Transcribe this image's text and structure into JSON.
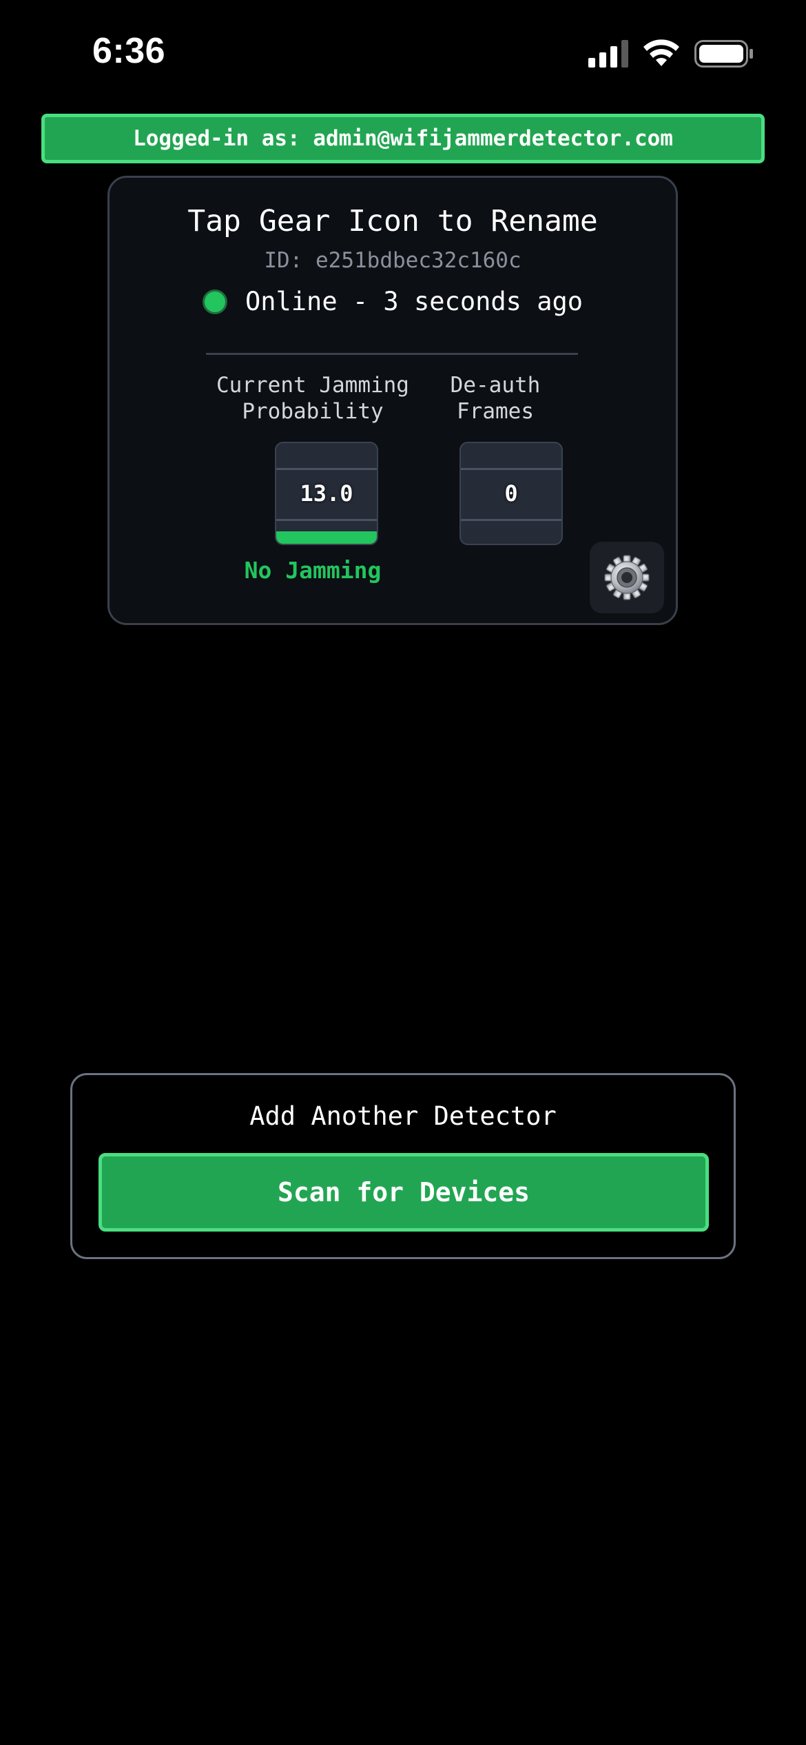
{
  "status_bar": {
    "time": "6:36"
  },
  "header": {
    "login_text": "Logged-in as: admin@wifijammerdetector.com"
  },
  "device": {
    "title": "Tap Gear Icon to Rename",
    "id_text": "ID: e251bdbec32c160c",
    "online_text": "Online - 3 seconds ago",
    "metrics": {
      "probability_label_line1": "Current Jamming",
      "probability_label_line2": "Probability",
      "probability_value": "13.0",
      "deauth_label_line1": "De-auth",
      "deauth_label_line2": "Frames",
      "deauth_value": "0"
    },
    "status_text": "No Jamming",
    "settings_icon": "gear-icon"
  },
  "add_detector": {
    "title": "Add Another Detector",
    "scan_button_label": "Scan for Devices"
  },
  "colors": {
    "accent_green": "#22a552",
    "accent_border": "#4ade80",
    "status_green": "#22c55e",
    "card_background": "#0c0f14",
    "page_background": "#000000"
  }
}
